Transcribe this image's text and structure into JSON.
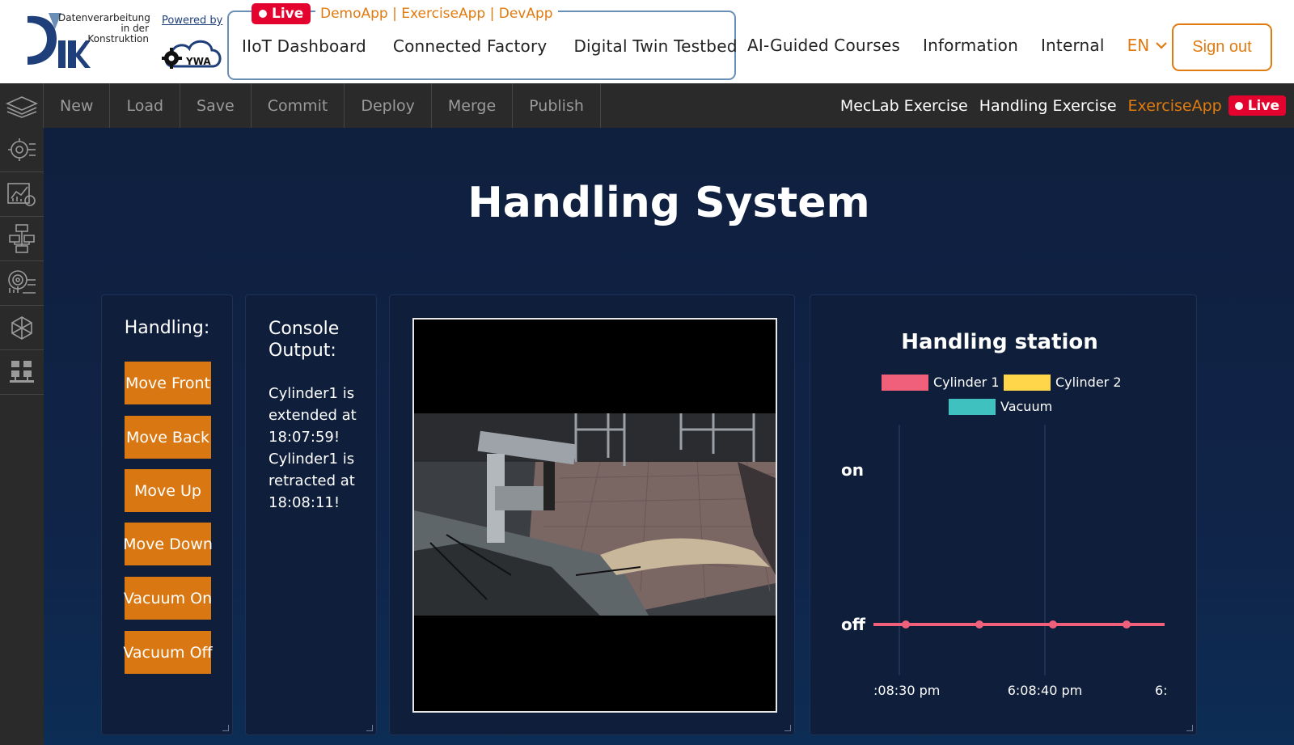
{
  "header": {
    "logo_text": "Datenverarbeitung in der Konstruktion",
    "powered_by": "Powered by",
    "partner_logo_text": "YWA",
    "live_label": "Live",
    "apps_label": "DemoApp | ExerciseApp | DevApp",
    "group_nav": [
      "IIoT Dashboard",
      "Connected Factory",
      "Digital Twin Testbed"
    ],
    "nav": [
      "AI-Guided Courses",
      "Information",
      "Internal"
    ],
    "language": "EN",
    "sign_out": "Sign out"
  },
  "toolbar": {
    "buttons": [
      "New",
      "Load",
      "Save",
      "Commit",
      "Deploy",
      "Merge",
      "Publish"
    ],
    "breadcrumb": [
      "MecLab Exercise",
      "Handling Exercise"
    ],
    "app_name": "ExerciseApp",
    "live_label": "Live"
  },
  "sidebar": {
    "icons": [
      "layers-icon",
      "settings-cloud-icon",
      "analytics-icon",
      "flowchart-icon",
      "target-icon",
      "network-cube-icon",
      "grid-apps-icon"
    ]
  },
  "main": {
    "title": "Handling System",
    "handling": {
      "title": "Handling:",
      "buttons": [
        "Move Front",
        "Move Back",
        "Move Up",
        "Move Down",
        "Vacuum On",
        "Vacuum Off"
      ]
    },
    "console": {
      "title": "Console Output:",
      "text": "Cylinder1 is extended at 18:07:59! Cylinder1 is retracted at 18:08:11!"
    },
    "video": {
      "icon": "camera-feed-icon"
    }
  },
  "colors": {
    "accent": "#d97812",
    "live": "#e4032e",
    "cylinder1": "#f0607a",
    "cylinder2": "#ffd54a",
    "vacuum": "#3fc1c0"
  },
  "chart_data": {
    "type": "line",
    "title": "Handling station",
    "series": [
      {
        "name": "Cylinder 1",
        "color": "#f0607a",
        "values": [
          "off",
          "off",
          "off",
          "off"
        ]
      },
      {
        "name": "Cylinder 2",
        "color": "#ffd54a",
        "values": []
      },
      {
        "name": "Vacuum",
        "color": "#3fc1c0",
        "values": []
      }
    ],
    "x_ticks": [
      ":08:30 pm",
      "6:08:40 pm",
      "6:"
    ],
    "y_categories": [
      "off",
      "on"
    ],
    "legend_position": "top"
  }
}
